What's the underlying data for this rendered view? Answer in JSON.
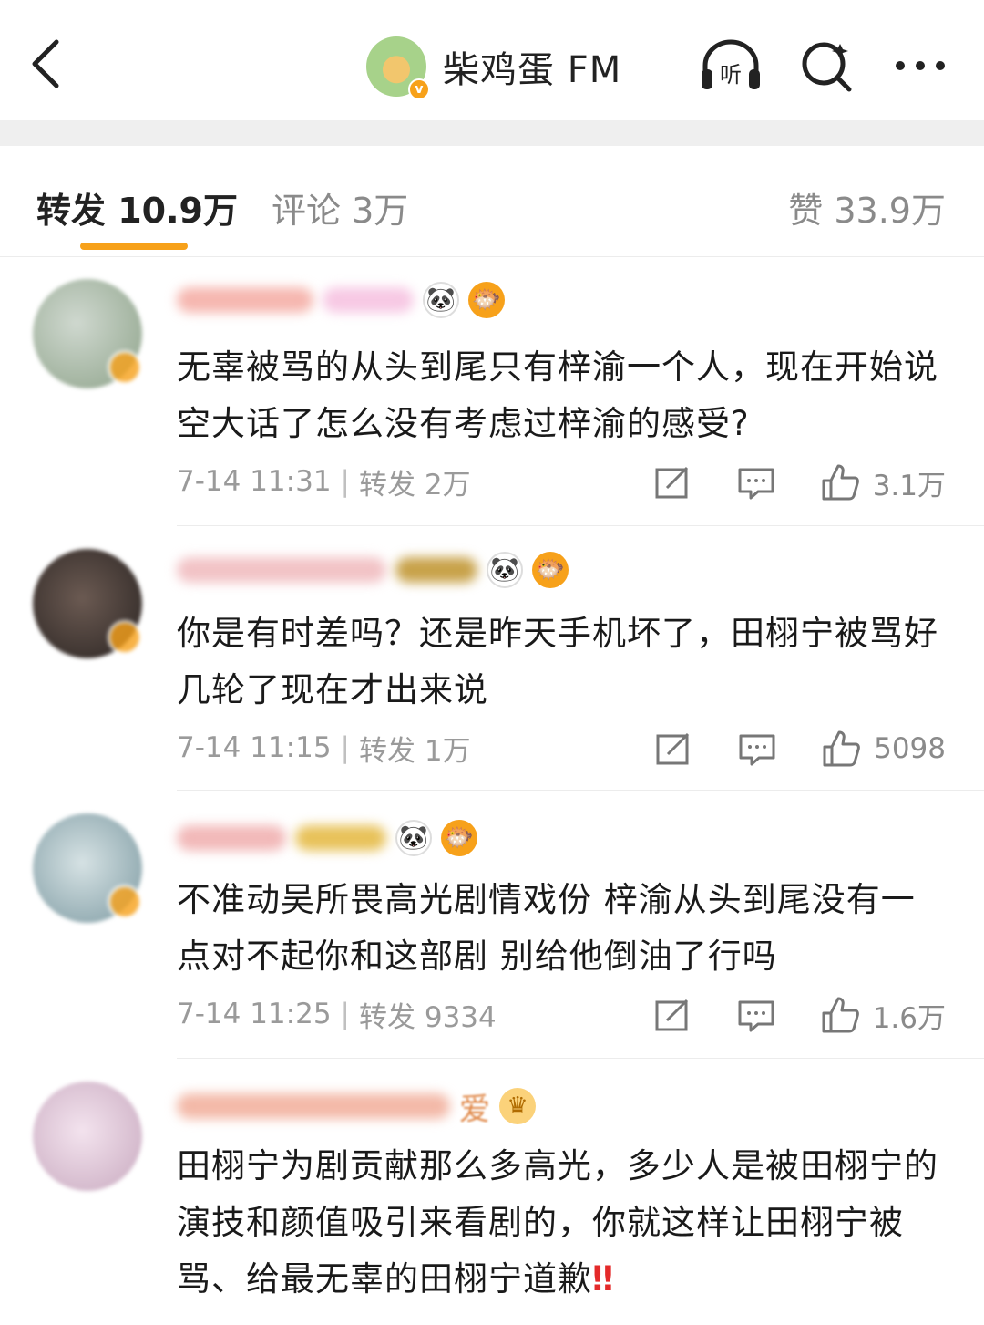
{
  "header": {
    "title": "柴鸡蛋 FM",
    "verified_mark": "v",
    "listen_label": "听"
  },
  "tabs": {
    "repost": "转发 10.9万",
    "comment": "评论 3万",
    "like": "赞 33.9万"
  },
  "colors": {
    "accent": "#f7a11a",
    "text": "#1a1a1a",
    "muted": "#9a9a9a"
  },
  "reposts": [
    {
      "text": "无辜被骂的从头到尾只有梓渝一个人，现在开始说空大话了怎么没有考虑过梓渝的感受?",
      "time": "7-14 11:31",
      "repost": "转发 2万",
      "likes": "3.1万",
      "badges": [
        "panda-icon",
        "fish-icon"
      ]
    },
    {
      "text": "你是有时差吗？还是昨天手机坏了，田栩宁被骂好几轮了现在才出来说",
      "time": "7-14 11:15",
      "repost": "转发 1万",
      "likes": "5098",
      "badges": [
        "panda-icon",
        "fish-icon"
      ]
    },
    {
      "text": "不准动吴所畏高光剧情戏份 梓渝从头到尾没有一点对不起你和这部剧 别给他倒油了行吗",
      "time": "7-14 11:25",
      "repost": "转发 9334",
      "likes": "1.6万",
      "badges": [
        "panda-icon",
        "fish-icon"
      ]
    },
    {
      "text": "田栩宁为剧贡献那么多高光，多少人是被田栩宁的演技和颜值吸引来看剧的，你就这样让田栩宁被骂、给最无辜的田栩宁道歉",
      "exclaim": "‼",
      "name_visible": "爱",
      "badges": [
        "crown-icon"
      ]
    }
  ]
}
